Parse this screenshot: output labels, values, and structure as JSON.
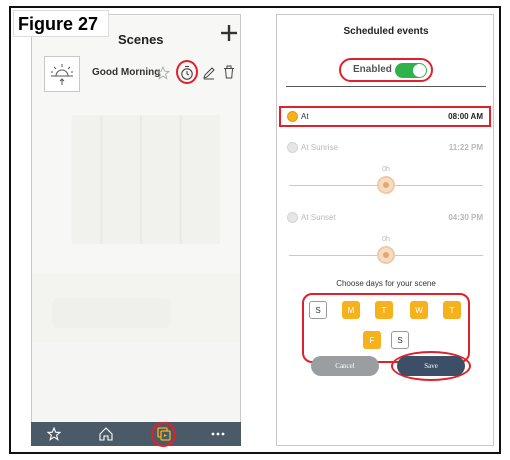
{
  "figure_label": "Figure 27",
  "left_screen": {
    "title": "Scenes",
    "add_icon": "plus-icon",
    "scene": {
      "name": "Good Morning",
      "icon": "sunrise-icon",
      "actions": [
        "star-icon",
        "clock-icon",
        "pencil-icon",
        "trash-icon"
      ]
    },
    "bottom_nav": [
      "star-icon",
      "home-icon",
      "scenes-icon",
      "more-icon"
    ],
    "bottom_nav_color": "#4a5a68"
  },
  "right_screen": {
    "title": "Scheduled events",
    "enabled_label": "Enabled",
    "enabled": true,
    "events": [
      {
        "label": "At",
        "time": "08:00 AM",
        "selected": true
      },
      {
        "label": "At Sunrise",
        "time": "11:22 PM",
        "selected": false,
        "offset": "0h"
      },
      {
        "label": "At Sunset",
        "time": "04:30 PM",
        "selected": false,
        "offset": "0h"
      }
    ],
    "days_title": "Choose days for your scene",
    "days": [
      {
        "label": "S",
        "on": false
      },
      {
        "label": "M",
        "on": true
      },
      {
        "label": "T",
        "on": true
      },
      {
        "label": "W",
        "on": true
      },
      {
        "label": "T",
        "on": true
      },
      {
        "label": "F",
        "on": true
      },
      {
        "label": "S",
        "on": false
      }
    ],
    "cancel_label": "Cancel",
    "save_label": "Save"
  },
  "colors": {
    "accent": "#f6b21d",
    "toggle_on": "#2fb24b",
    "highlight": "#e0212b",
    "save": "#3c4f66",
    "cancel": "#9a9ea1"
  }
}
